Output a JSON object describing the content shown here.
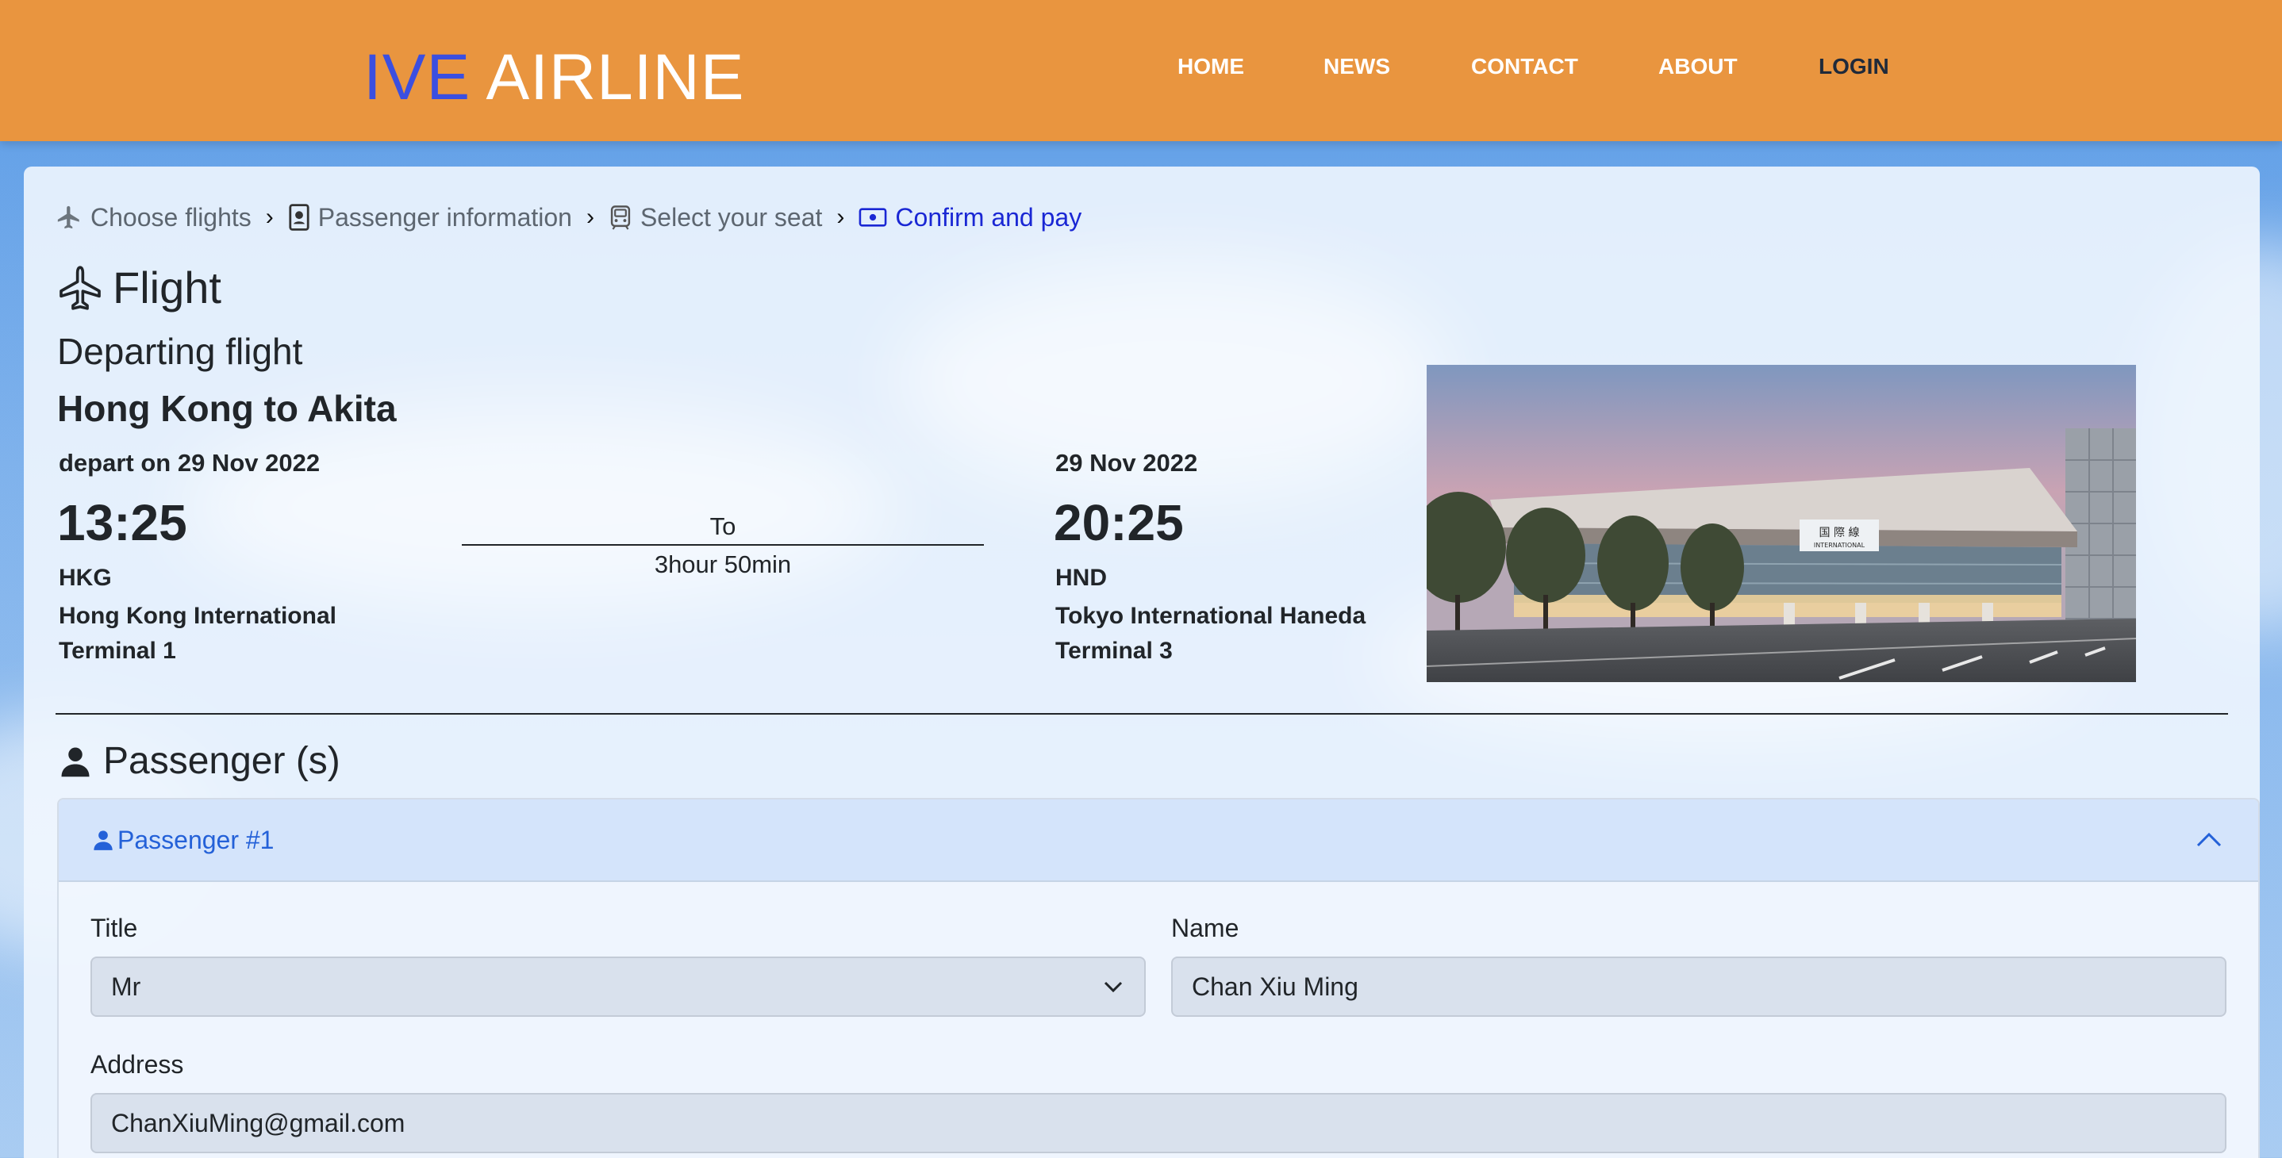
{
  "header": {
    "logo_part1": "IVE",
    "logo_part2": "AIRLINE",
    "nav": [
      "HOME",
      "NEWS",
      "CONTACT",
      "ABOUT",
      "LOGIN"
    ]
  },
  "breadcrumb": [
    {
      "label": "Choose flights",
      "icon": "plane-icon"
    },
    {
      "label": "Passenger information",
      "icon": "passport-icon"
    },
    {
      "label": "Select your seat",
      "icon": "seat-icon"
    },
    {
      "label": "Confirm and pay",
      "icon": "cash-icon",
      "active": true
    }
  ],
  "flight": {
    "heading": "Flight",
    "subheading": "Departing flight",
    "route": "Hong Kong to Akita",
    "depart": {
      "date": "depart on 29 Nov 2022",
      "time": "13:25",
      "code": "HKG",
      "airport": "Hong Kong International",
      "terminal": "Terminal 1"
    },
    "connector": {
      "label": "To",
      "duration": "3hour 50min"
    },
    "arrive": {
      "date": "29 Nov 2022",
      "time": "20:25",
      "code": "HND",
      "airport": "Tokyo International Haneda",
      "terminal": "Terminal 3"
    },
    "photo_sign_main": "国 際 線",
    "photo_sign_sub": "INTERNATIONAL"
  },
  "passengers": {
    "heading": "Passenger (s)",
    "items": [
      {
        "title": "Passenger #1",
        "fields": {
          "title_label": "Title",
          "title_value": "Mr",
          "name_label": "Name",
          "name_value": "Chan Xiu Ming",
          "address_label": "Address",
          "address_value": "ChanXiuMing@gmail.com"
        }
      }
    ]
  },
  "colors": {
    "header_bg": "#e9953f",
    "logo_accent": "#3b4fe0",
    "active_crumb": "#1a27d4",
    "accordion_head": "#d4e4fb",
    "accordion_text": "#2461d8"
  }
}
